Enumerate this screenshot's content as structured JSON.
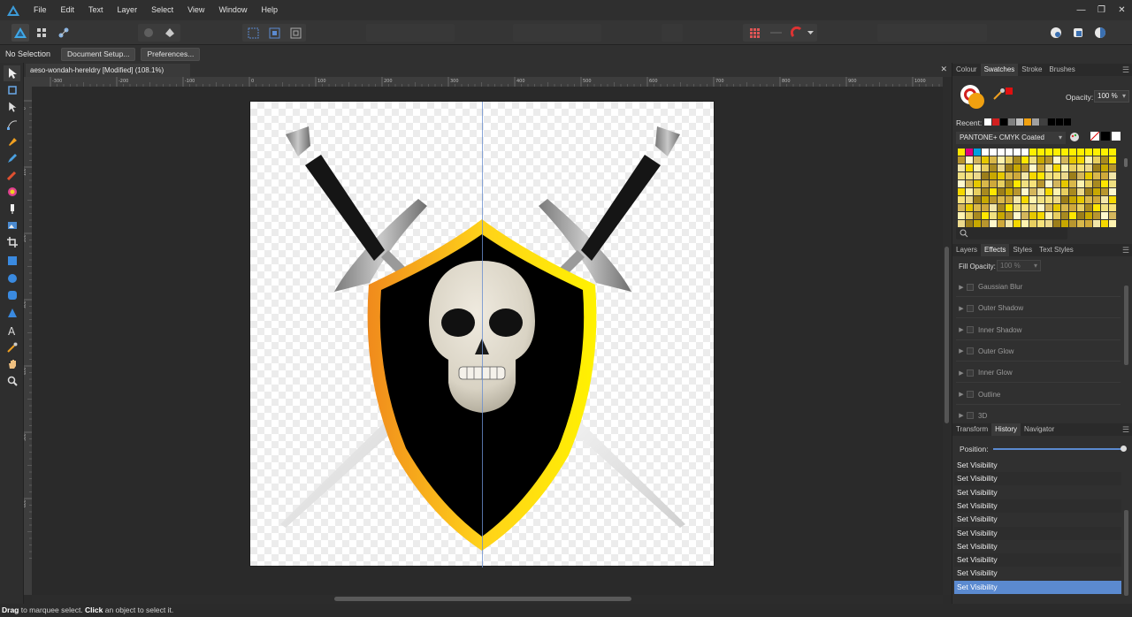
{
  "menubar": {
    "items": [
      "File",
      "Edit",
      "Text",
      "Layer",
      "Select",
      "View",
      "Window",
      "Help"
    ]
  },
  "context_bar": {
    "selection_label": "No Selection",
    "document_setup_label": "Document Setup...",
    "preferences_label": "Preferences..."
  },
  "document": {
    "tab_title": "aeso-wondah-hereldry [Modified] (108.1%)"
  },
  "rulers": {
    "horizontal_ticks": [
      "-300",
      "-200",
      "-100",
      "0",
      "100",
      "200",
      "300",
      "400",
      "500",
      "600",
      "700",
      "800",
      "900",
      "1000"
    ],
    "vertical_ticks": [
      "0",
      "100",
      "200",
      "300",
      "400",
      "500",
      "600"
    ]
  },
  "panels": {
    "top_tabs": [
      "Colour",
      "Swatches",
      "Stroke",
      "Brushes"
    ],
    "top_active": "Swatches",
    "opacity_label": "Opacity:",
    "opacity_value": "100 %",
    "recent_label": "Recent:",
    "palette_name": "PANTONE+ CMYK Coated",
    "mid_tabs": [
      "Layers",
      "Effects",
      "Styles",
      "Text Styles"
    ],
    "mid_active": "Effects",
    "fill_opacity_label": "Fill Opacity:",
    "fill_opacity_value": "100 %",
    "effects": [
      "Gaussian Blur",
      "Outer Shadow",
      "Inner Shadow",
      "Outer Glow",
      "Inner Glow",
      "Outline",
      "3D"
    ],
    "bottom_tabs": [
      "Transform",
      "History",
      "Navigator"
    ],
    "bottom_active": "History",
    "position_label": "Position:",
    "history": [
      "Set Visibility",
      "Set Visibility",
      "Set Visibility",
      "Set Visibility",
      "Set Visibility",
      "Set Visibility",
      "Set Visibility",
      "Set Visibility",
      "Set Visibility",
      "Set Visibility"
    ],
    "history_position": 1.0
  },
  "statusbar": {
    "drag_word": "Drag",
    "drag_text": " to marquee select. ",
    "click_word": "Click",
    "click_text": " an object to select it."
  },
  "colors": {
    "accent": "#5b8ad0",
    "shield_gold": "#ffd21a",
    "shield_orange": "#f08a1c",
    "shield_body": "#000000"
  }
}
